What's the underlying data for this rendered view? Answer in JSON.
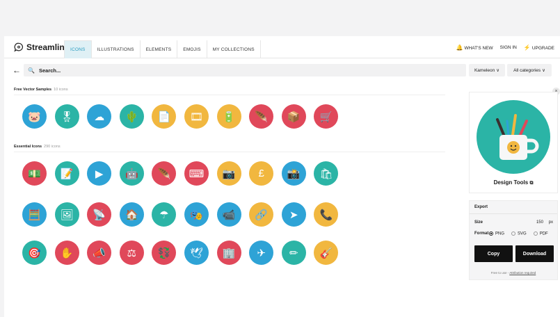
{
  "brand": {
    "name": "Streamline"
  },
  "nav": {
    "tabs": [
      "ICONS",
      "ILLUSTRATIONS",
      "ELEMENTS",
      "EMOJIS",
      "MY COLLECTIONS"
    ],
    "active_tab": "ICONS",
    "whats_new": "WHAT'S NEW",
    "sign_in": "SIGN IN",
    "upgrade": "UPGRADE"
  },
  "search": {
    "placeholder": "Search..."
  },
  "filters": {
    "style": "Kameleon",
    "categories": "All categories"
  },
  "sections": [
    {
      "title": "Free Vector Samples",
      "count": "10 icons"
    },
    {
      "title": "Essential Icons",
      "count": "290 icons"
    }
  ],
  "icons_row1": [
    {
      "name": "piggy-bank-icon",
      "color": "#2ea3d6",
      "glyph": "🐷"
    },
    {
      "name": "medal-icon",
      "color": "#2bb4a6",
      "glyph": "🎖"
    },
    {
      "name": "cloud-download-icon",
      "color": "#2ea3d6",
      "glyph": "☁"
    },
    {
      "name": "cactus-icon",
      "color": "#2bb4a6",
      "glyph": "🌵"
    },
    {
      "name": "bookmark-document-icon",
      "color": "#f1b73f",
      "glyph": "📄"
    },
    {
      "name": "film-icon",
      "color": "#f1b73f",
      "glyph": "🎞"
    },
    {
      "name": "battery-icon",
      "color": "#f1b73f",
      "glyph": "🔋"
    },
    {
      "name": "feather-icon",
      "color": "#e0485a",
      "glyph": "🪶"
    },
    {
      "name": "box-icon",
      "color": "#e0485a",
      "glyph": "📦"
    },
    {
      "name": "hand-truck-icon",
      "color": "#e0485a",
      "glyph": "🛒"
    }
  ],
  "icons_row2": [
    {
      "name": "cash-withdraw-icon",
      "color": "#e0485a",
      "glyph": "💵"
    },
    {
      "name": "edit-document-icon",
      "color": "#2bb4a6",
      "glyph": "📝"
    },
    {
      "name": "video-player-icon",
      "color": "#2ea3d6",
      "glyph": "▶"
    },
    {
      "name": "robot-icon",
      "color": "#2bb4a6",
      "glyph": "🤖"
    },
    {
      "name": "feather-quill-icon",
      "color": "#e0485a",
      "glyph": "🪶"
    },
    {
      "name": "wireless-keyboard-icon",
      "color": "#e0485a",
      "glyph": "⌨"
    },
    {
      "name": "camera-icon",
      "color": "#f1b73f",
      "glyph": "📷"
    },
    {
      "name": "pound-coin-icon",
      "color": "#f1b73f",
      "glyph": "£"
    },
    {
      "name": "photo-camera-icon",
      "color": "#2ea3d6",
      "glyph": "📸"
    },
    {
      "name": "shopping-bag-icon",
      "color": "#2bb4a6",
      "glyph": "🛍"
    }
  ],
  "icons_row3": [
    {
      "name": "calculator-icon",
      "color": "#2ea3d6",
      "glyph": "🧮"
    },
    {
      "name": "picture-frame-icon",
      "color": "#2bb4a6",
      "glyph": "🖼"
    },
    {
      "name": "broadcast-tower-icon",
      "color": "#e0485a",
      "glyph": "📡"
    },
    {
      "name": "house-key-icon",
      "color": "#2ea3d6",
      "glyph": "🏠"
    },
    {
      "name": "umbrella-money-icon",
      "color": "#2bb4a6",
      "glyph": "☂"
    },
    {
      "name": "presentation-stage-icon",
      "color": "#2ea3d6",
      "glyph": "🎭"
    },
    {
      "name": "video-call-icon",
      "color": "#2ea3d6",
      "glyph": "📹"
    },
    {
      "name": "hierarchy-icon",
      "color": "#f1b73f",
      "glyph": "🔗"
    },
    {
      "name": "navigation-arrow-icon",
      "color": "#2ea3d6",
      "glyph": "➤"
    },
    {
      "name": "phone-icon",
      "color": "#f1b73f",
      "glyph": "📞"
    }
  ],
  "icons_row4": [
    {
      "name": "target-icon",
      "color": "#2bb4a6",
      "glyph": "🎯"
    },
    {
      "name": "stop-hand-icon",
      "color": "#e0485a",
      "glyph": "✋"
    },
    {
      "name": "megaphone-icon",
      "color": "#e0485a",
      "glyph": "📣"
    },
    {
      "name": "scales-icon",
      "color": "#e0485a",
      "glyph": "⚖"
    },
    {
      "name": "currency-exchange-icon",
      "color": "#e0485a",
      "glyph": "💱"
    },
    {
      "name": "origami-bird-icon",
      "color": "#2ea3d6",
      "glyph": "🕊"
    },
    {
      "name": "building-icon",
      "color": "#e0485a",
      "glyph": "🏢"
    },
    {
      "name": "paper-plane-icon",
      "color": "#2ea3d6",
      "glyph": "✈"
    },
    {
      "name": "pencil-ruler-icon",
      "color": "#2bb4a6",
      "glyph": "✏"
    },
    {
      "name": "guitar-icon",
      "color": "#f1b73f",
      "glyph": "🎸"
    }
  ],
  "preview": {
    "title": "Design Tools",
    "circle_color": "#2bb4a6"
  },
  "export": {
    "header": "Export",
    "size_label": "Size",
    "size_value": "150",
    "size_unit": "px",
    "format_label": "Format",
    "formats": [
      "PNG",
      "SVG",
      "PDF"
    ],
    "selected_format": "PNG",
    "copy": "Copy",
    "download": "Download",
    "footer_prefix": "Free to use -",
    "footer_link": "Attribution required"
  }
}
